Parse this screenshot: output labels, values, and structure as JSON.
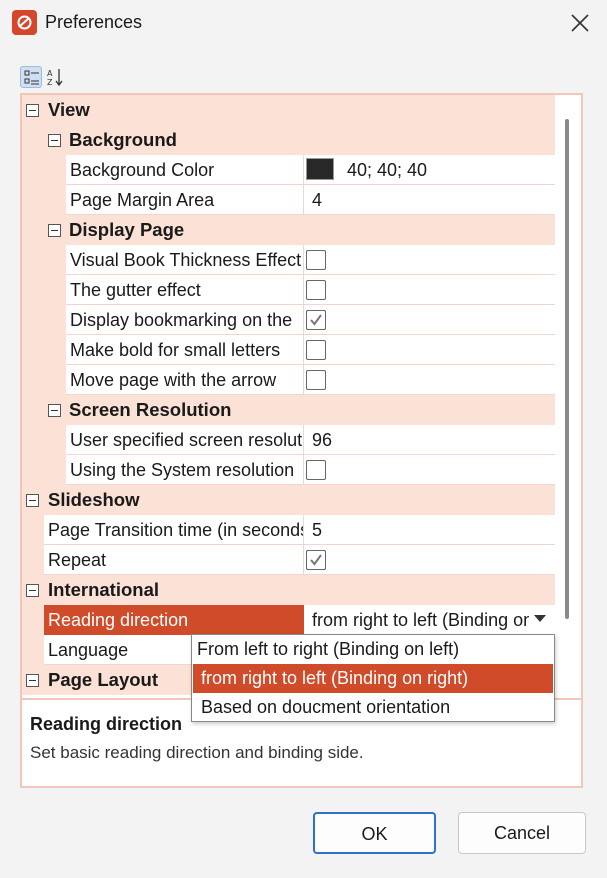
{
  "window": {
    "title": "Preferences"
  },
  "toolbar": {
    "categorized_icon": "categorized-view-icon",
    "alphabetical_icon": "sort-az-icon"
  },
  "grid": {
    "view": {
      "label": "View",
      "background": {
        "label": "Background",
        "color_name": "Background Color",
        "color_value": "40; 40; 40",
        "color_hex": "#282828",
        "margin_name": "Page Margin Area",
        "margin_value": "4"
      },
      "display_page": {
        "label": "Display Page",
        "thickness_name": "Visual Book Thickness Effect",
        "thickness_checked": false,
        "gutter_name": "The gutter effect",
        "gutter_checked": false,
        "bookmark_name": "Display bookmarking on the",
        "bookmark_checked": true,
        "bold_name": "Make bold for small letters",
        "bold_checked": false,
        "arrow_name": "Move page with the arrow",
        "arrow_checked": false
      },
      "screen_resolution": {
        "label": "Screen Resolution",
        "user_res_name": "User specified screen resolution",
        "user_res_value": "96",
        "system_res_name": "Using the System resolution",
        "system_res_checked": false
      }
    },
    "slideshow": {
      "label": "Slideshow",
      "transition_name": "Page Transition time (in seconds)",
      "transition_value": "5",
      "repeat_name": "Repeat",
      "repeat_checked": true
    },
    "international": {
      "label": "International",
      "reading_name": "Reading direction",
      "reading_value": "from right to left (Binding on right)",
      "language_name": "Language"
    },
    "page_layout": {
      "label": "Page Layout"
    }
  },
  "dropdown": {
    "options": [
      "From left to right (Binding on left)",
      "from right to left (Binding on right)",
      "Based on doucment orientation"
    ],
    "selected_index": 1
  },
  "description": {
    "title": "Reading direction",
    "text": "Set basic reading direction and binding side."
  },
  "buttons": {
    "ok": "OK",
    "cancel": "Cancel"
  },
  "colors": {
    "accent": "#d04b29",
    "category_bg": "#fbe1d6",
    "ok_border": "#2c72c9"
  }
}
